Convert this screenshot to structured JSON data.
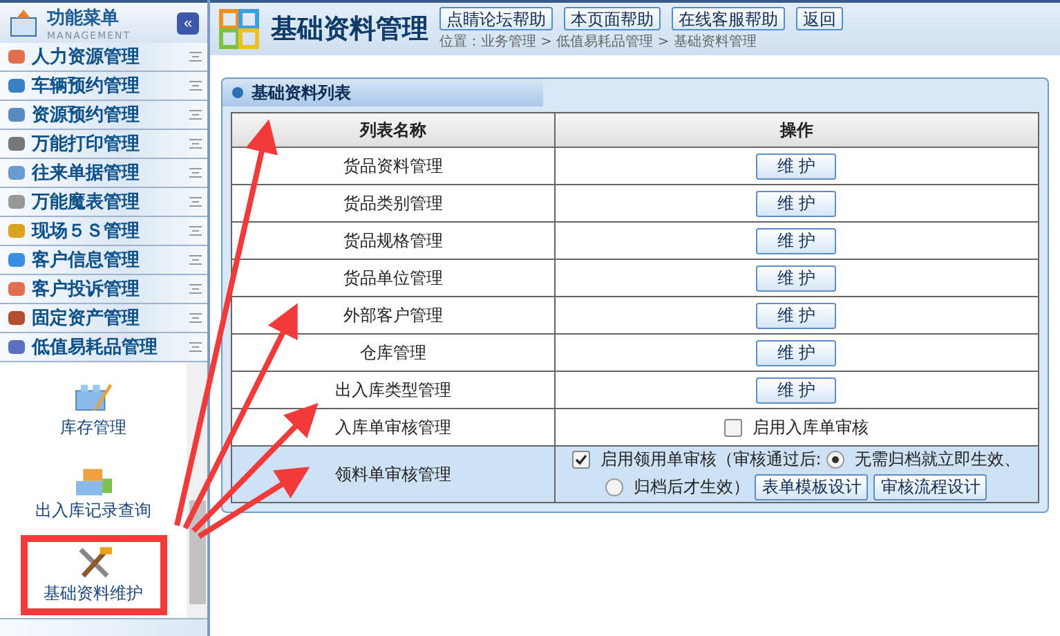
{
  "sidebar": {
    "title": "功能菜单",
    "subtitle": "MANAGEMENT",
    "collapse_label": "«",
    "items": [
      {
        "label": "人力资源管理"
      },
      {
        "label": "车辆预约管理"
      },
      {
        "label": "资源预约管理"
      },
      {
        "label": "万能打印管理"
      },
      {
        "label": "往来单据管理"
      },
      {
        "label": "万能魔表管理"
      },
      {
        "label": "现场５Ｓ管理"
      },
      {
        "label": "客户信息管理"
      },
      {
        "label": "客户投诉管理"
      },
      {
        "label": "固定资产管理"
      },
      {
        "label": "低值易耗品管理"
      }
    ],
    "sub_items": [
      {
        "label": "库存管理",
        "selected": false
      },
      {
        "label": "出入库记录查询",
        "selected": false
      },
      {
        "label": "基础资料维护",
        "selected": true
      }
    ]
  },
  "header": {
    "title": "基础资料管理",
    "buttons": [
      "点睛论坛帮助",
      "本页面帮助",
      "在线客服帮助",
      "返回"
    ],
    "breadcrumb": "位置：业务管理 > 低值易耗品管理 > 基础资料管理"
  },
  "panel": {
    "title": "基础资料列表",
    "columns": [
      "列表名称",
      "操作"
    ],
    "rows": [
      {
        "name": "货品资料管理",
        "kind": "button",
        "action": "维 护"
      },
      {
        "name": "货品类别管理",
        "kind": "button",
        "action": "维 护"
      },
      {
        "name": "货品规格管理",
        "kind": "button",
        "action": "维 护"
      },
      {
        "name": "货品单位管理",
        "kind": "button",
        "action": "维 护"
      },
      {
        "name": "外部客户管理",
        "kind": "button",
        "action": "维 护"
      },
      {
        "name": "仓库管理",
        "kind": "button",
        "action": "维 护"
      },
      {
        "name": "出入库类型管理",
        "kind": "button",
        "action": "维 护"
      },
      {
        "name": "入库单审核管理",
        "kind": "checkbox",
        "checkbox": {
          "label": "启用入库单审核",
          "checked": false
        }
      },
      {
        "name": "领料单审核管理",
        "kind": "options",
        "highlighted": true,
        "checkbox": {
          "label": "启用领用单审核（审核通过后:",
          "checked": true
        },
        "radios": [
          {
            "label": "无需归档就立即生效、",
            "selected": true
          },
          {
            "label": "归档后才生效）",
            "selected": false
          }
        ],
        "buttons": [
          "表单模板设计",
          "审核流程设计"
        ]
      }
    ]
  }
}
